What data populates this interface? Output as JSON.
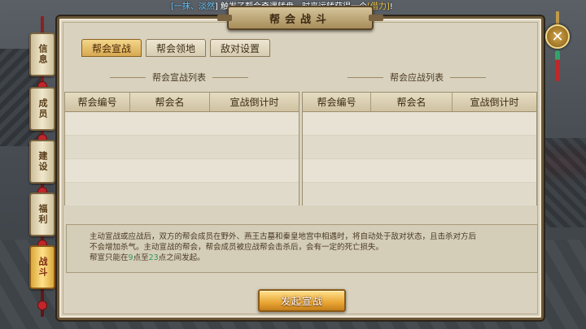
{
  "marquee": {
    "prefix": "[一抹、",
    "player": "淡然",
    "mid": "] 触发了帮会奇遇转盘，时来运转获得一个",
    "item": "[借力]",
    "suffix": "!"
  },
  "window_title": "帮会战斗",
  "side_tabs": [
    "信息",
    "成员",
    "建设",
    "福利",
    "战斗"
  ],
  "active_side_tab": "战斗",
  "tabs": [
    "帮会宣战",
    "帮会领地",
    "敌对设置"
  ],
  "active_tab": "帮会宣战",
  "declare_list": {
    "title": "帮会宣战列表",
    "columns": [
      "帮会编号",
      "帮会名",
      "宣战倒计时"
    ],
    "rows": []
  },
  "respond_list": {
    "title": "帮会应战列表",
    "columns": [
      "帮会编号",
      "帮会名",
      "宣战倒计时"
    ],
    "rows": []
  },
  "notes": {
    "line1": "主动宣战或应战后，双方的帮会成员在野外、燕王古墓和秦皇地宫中相遇时，将自动处于敌对状态，且击杀对方后",
    "line2": "不会增加杀气。主动宣战的帮会，帮会成员被应战帮会击杀后，会有一定的死亡损失。",
    "line3_a": "帮宣只能在",
    "line3_h1": "9",
    "line3_b": "点至",
    "line3_h2": "23",
    "line3_c": "点之间发起。"
  },
  "launch_button": "发起宣战",
  "close_icon": "close-x-icon"
}
